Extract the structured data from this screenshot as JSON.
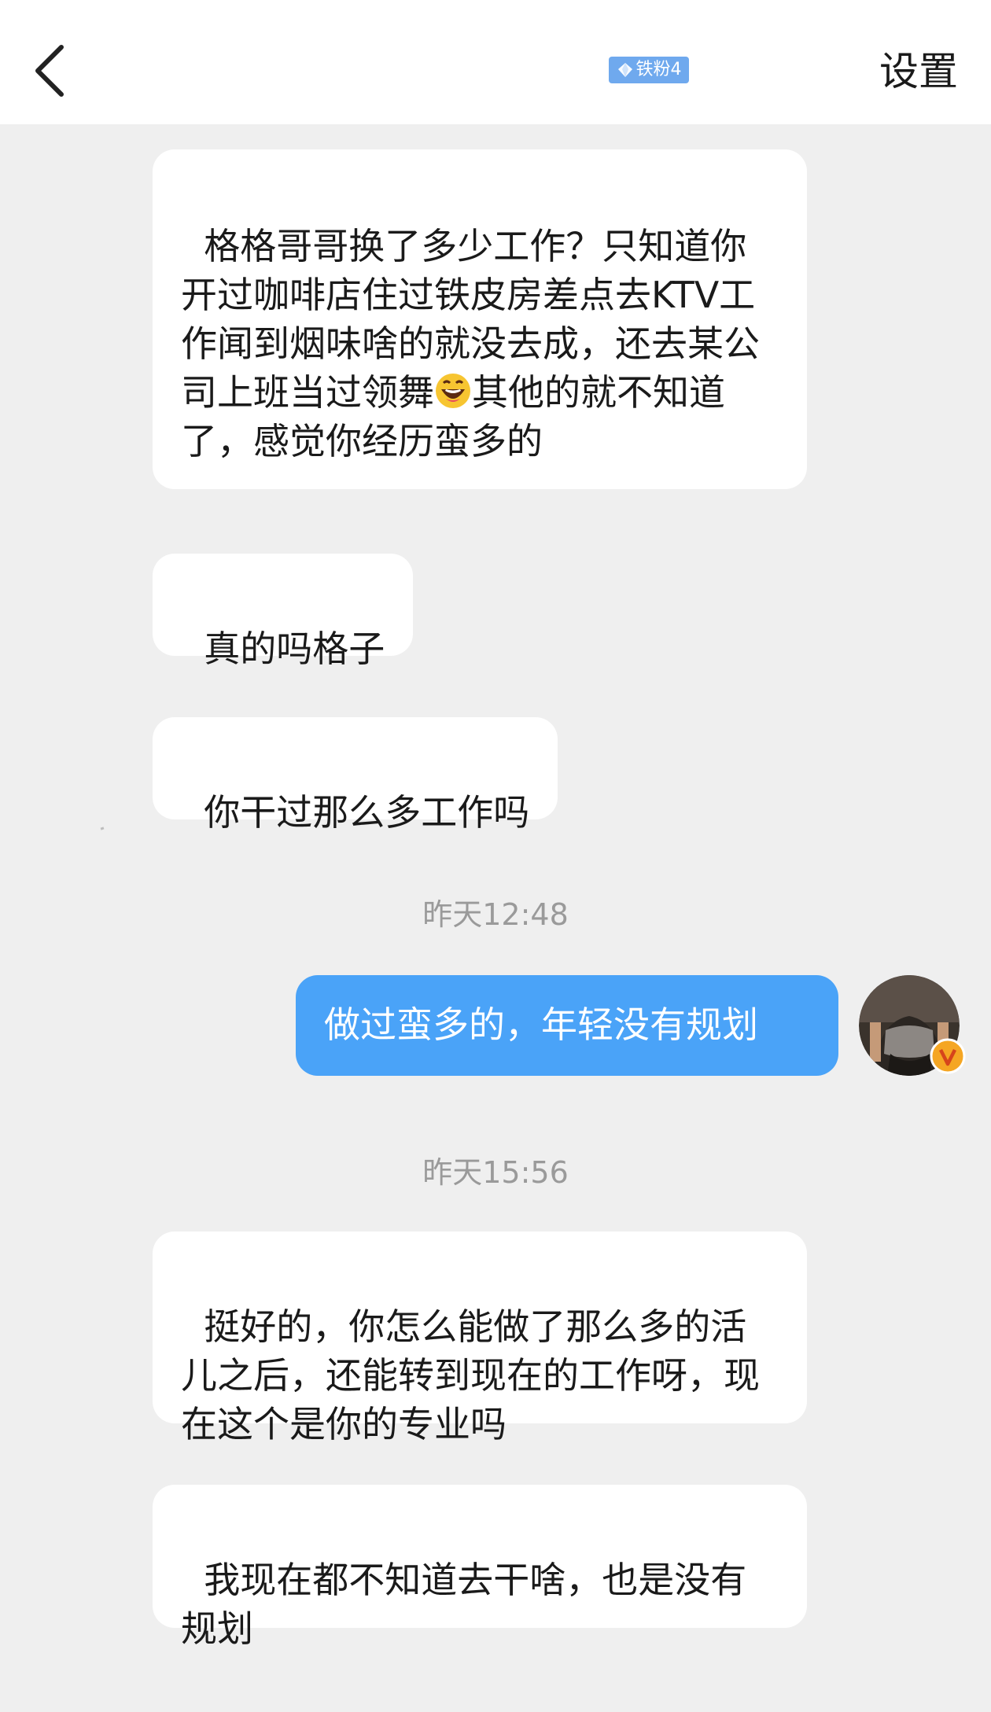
{
  "header": {
    "back_icon": "chevron-left-icon",
    "fan_badge": "铁粉4",
    "fan_badge_icon": "diamond-icon",
    "settings_label": "设置"
  },
  "messages": [
    {
      "side": "left",
      "text": "格格哥哥换了多少工作？只知道你开过咖啡店住过铁皮房差点去KTV工作闻到烟味啥的就没去成，还去某公司上班当过领舞",
      "tail": "其他的就不知道了，感觉你经历蛮多的",
      "emoji": "grinning-sweat-emoji"
    },
    {
      "side": "left",
      "text": "真的吗格子"
    },
    {
      "side": "left",
      "text": "你干过那么多工作吗"
    },
    {
      "type": "time",
      "text": "昨天12:48"
    },
    {
      "side": "right",
      "text": "做过蛮多的，年轻没有规划"
    },
    {
      "type": "time",
      "text": "昨天15:56"
    },
    {
      "side": "left",
      "text": "挺好的，你怎么能做了那么多的活儿之后，还能转到现在的工作呀，现在这个是你的专业吗"
    },
    {
      "side": "left",
      "text": "我现在都不知道去干啥，也是没有规划"
    }
  ],
  "colors": {
    "background": "#efefef",
    "incoming_bubble": "#ffffff",
    "outgoing_bubble": "#4aa3f8",
    "timestamp": "#9a9a9a",
    "fan_badge": "#6fa9ee",
    "verified_badge": "#f5a623"
  }
}
